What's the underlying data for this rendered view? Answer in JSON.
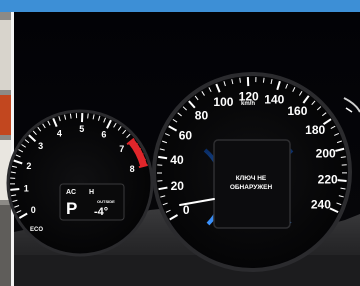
{
  "tachometer": {
    "numbers": [
      "0",
      "1",
      "2",
      "3",
      "4",
      "5",
      "6",
      "7",
      "8"
    ],
    "redline_color": "#e0262b",
    "logo": "ECO",
    "display": {
      "row1_left": "AC",
      "row1_right": "H",
      "gear": "P",
      "outside_temp_label": "OUTSIDE",
      "outside_temp": "-4°"
    }
  },
  "speedometer": {
    "numbers": [
      "0",
      "20",
      "40",
      "60",
      "80",
      "100",
      "120",
      "140",
      "160",
      "180",
      "200",
      "220",
      "240"
    ],
    "unit": "km/h",
    "accent_color": "#2e7fd9",
    "warning": {
      "line1": "КЛЮЧ НЕ",
      "line2": "ОБНАРУЖЕН"
    }
  },
  "frame_color": "#3d8fd6"
}
